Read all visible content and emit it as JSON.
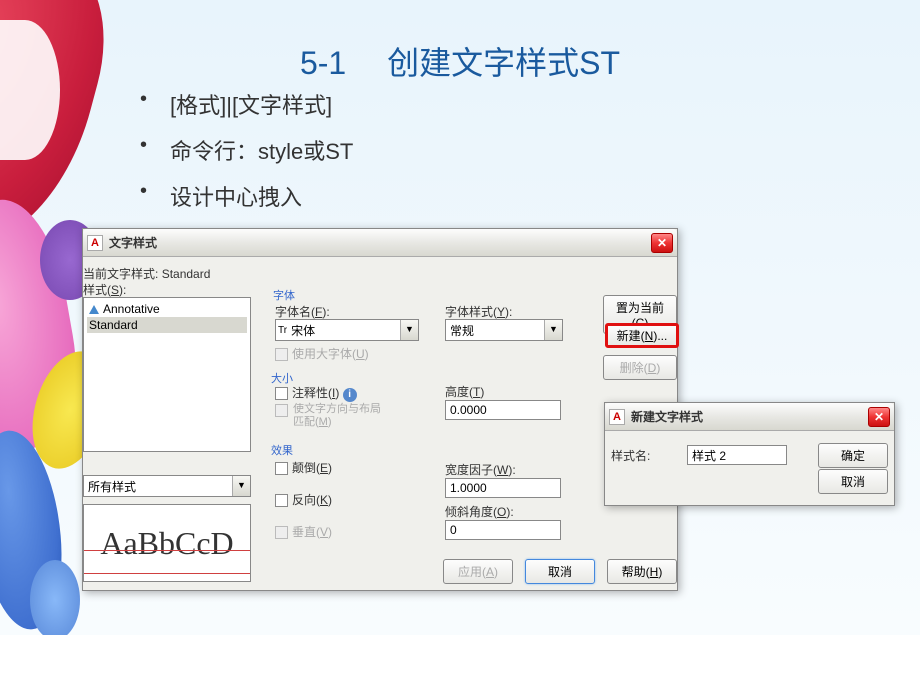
{
  "slide": {
    "title": "5-1　 创建文字样式ST",
    "bullets": [
      "[格式]|[文字样式]",
      "命令行：style或ST",
      "设计中心拽入"
    ]
  },
  "dialog": {
    "title": "文字样式",
    "current_label": "当前文字样式:",
    "current_value": "Standard",
    "styles_label": "样式(S):",
    "style_items": [
      "Annotative",
      "Standard"
    ],
    "filter_value": "所有样式",
    "preview": "AaBbCcD",
    "font": {
      "group": "字体",
      "name_label": "字体名(F):",
      "name_value": "宋体",
      "style_label": "字体样式(Y):",
      "style_value": "常规",
      "bigfont_label": "使用大字体(U)"
    },
    "size": {
      "group": "大小",
      "annotative_label": "注释性(I)",
      "match_label": "使文字方向与布局匹配(M)",
      "height_label": "高度(T)",
      "height_value": "0.0000"
    },
    "effects": {
      "group": "效果",
      "upside_label": "颠倒(E)",
      "backward_label": "反向(K)",
      "vertical_label": "垂直(V)",
      "width_label": "宽度因子(W):",
      "width_value": "1.0000",
      "oblique_label": "倾斜角度(O):",
      "oblique_value": "0"
    },
    "buttons": {
      "setcurrent": "置为当前(C)",
      "new": "新建(N)...",
      "delete": "删除(D)",
      "apply": "应用(A)",
      "cancel": "取消",
      "help": "帮助(H)"
    }
  },
  "newdialog": {
    "title": "新建文字样式",
    "name_label": "样式名:",
    "name_value": "样式 2",
    "ok": "确定",
    "cancel": "取消"
  }
}
